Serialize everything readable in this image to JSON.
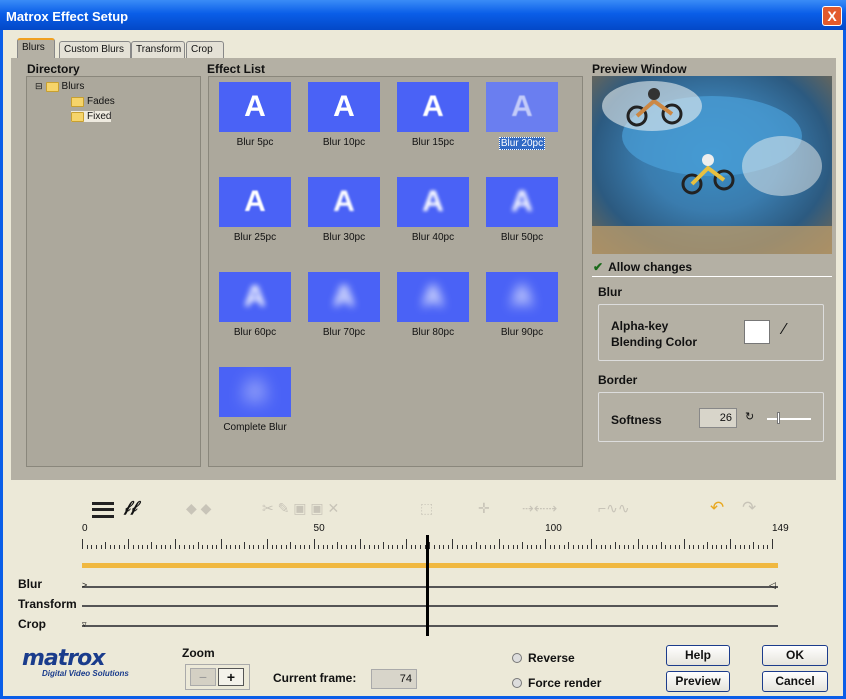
{
  "window": {
    "title": "Matrox Effect Setup",
    "close_glyph": "X"
  },
  "tabs": [
    {
      "label": "Blurs",
      "active": true
    },
    {
      "label": "Custom Blurs",
      "active": false
    },
    {
      "label": "Transform",
      "active": false
    },
    {
      "label": "Crop",
      "active": false
    }
  ],
  "directory": {
    "label": "Directory",
    "root": {
      "label": "Blurs",
      "expander": "⊟"
    },
    "children": [
      "Fades",
      "Fixed"
    ]
  },
  "effect_list": {
    "label": "Effect List",
    "items": [
      {
        "label": "Blur 5pc",
        "glyph": "A",
        "blur": 0
      },
      {
        "label": "Blur 10pc",
        "glyph": "A",
        "blur": 0.2
      },
      {
        "label": "Blur 15pc",
        "glyph": "A",
        "blur": 0.4
      },
      {
        "label": "Blur 20pc",
        "glyph": "A",
        "blur": 0.6,
        "selected": true
      },
      {
        "label": "Blur 25pc",
        "glyph": "A",
        "blur": 0.8
      },
      {
        "label": "Blur 30pc",
        "glyph": "A",
        "blur": 1
      },
      {
        "label": "Blur 40pc",
        "glyph": "A",
        "blur": 1.5
      },
      {
        "label": "Blur 50pc",
        "glyph": "A",
        "blur": 2
      },
      {
        "label": "Blur 60pc",
        "glyph": "A",
        "blur": 3
      },
      {
        "label": "Blur 70pc",
        "glyph": "A",
        "blur": 4
      },
      {
        "label": "Blur 80pc",
        "glyph": "A",
        "blur": 5
      },
      {
        "label": "Blur 90pc",
        "glyph": "A",
        "blur": 6
      },
      {
        "label": "Complete Blur",
        "glyph": "A",
        "blur": 9
      }
    ]
  },
  "preview": {
    "label": "Preview Window"
  },
  "allow_changes": {
    "label": "Allow changes",
    "checked": true
  },
  "blur_group": {
    "label": "Blur",
    "alpha_key_label": "Alpha-key",
    "blending_label": "Blending Color",
    "color": "#ffffff"
  },
  "border_group": {
    "label": "Border",
    "softness_label": "Softness",
    "softness_value": "26"
  },
  "timeline": {
    "ruler_labels": [
      "0",
      "50",
      "100",
      "149"
    ],
    "tracks": [
      "Blur",
      "Transform",
      "Crop"
    ],
    "current_frame_fraction": 0.5
  },
  "zoom": {
    "label": "Zoom",
    "minus": "−",
    "plus": "+"
  },
  "current_frame": {
    "label": "Current frame:",
    "value": "74"
  },
  "options": {
    "reverse": "Reverse",
    "force_render": "Force render"
  },
  "buttons": {
    "help": "Help",
    "ok": "OK",
    "preview": "Preview",
    "cancel": "Cancel"
  },
  "logo": {
    "name": "matrox",
    "tagline": "Digital Video Solutions"
  },
  "colors": {
    "accent": "#0a5ee8",
    "tile": "#4a62f6",
    "timeline_bar": "#f0b840",
    "selection": "#316ac5"
  }
}
